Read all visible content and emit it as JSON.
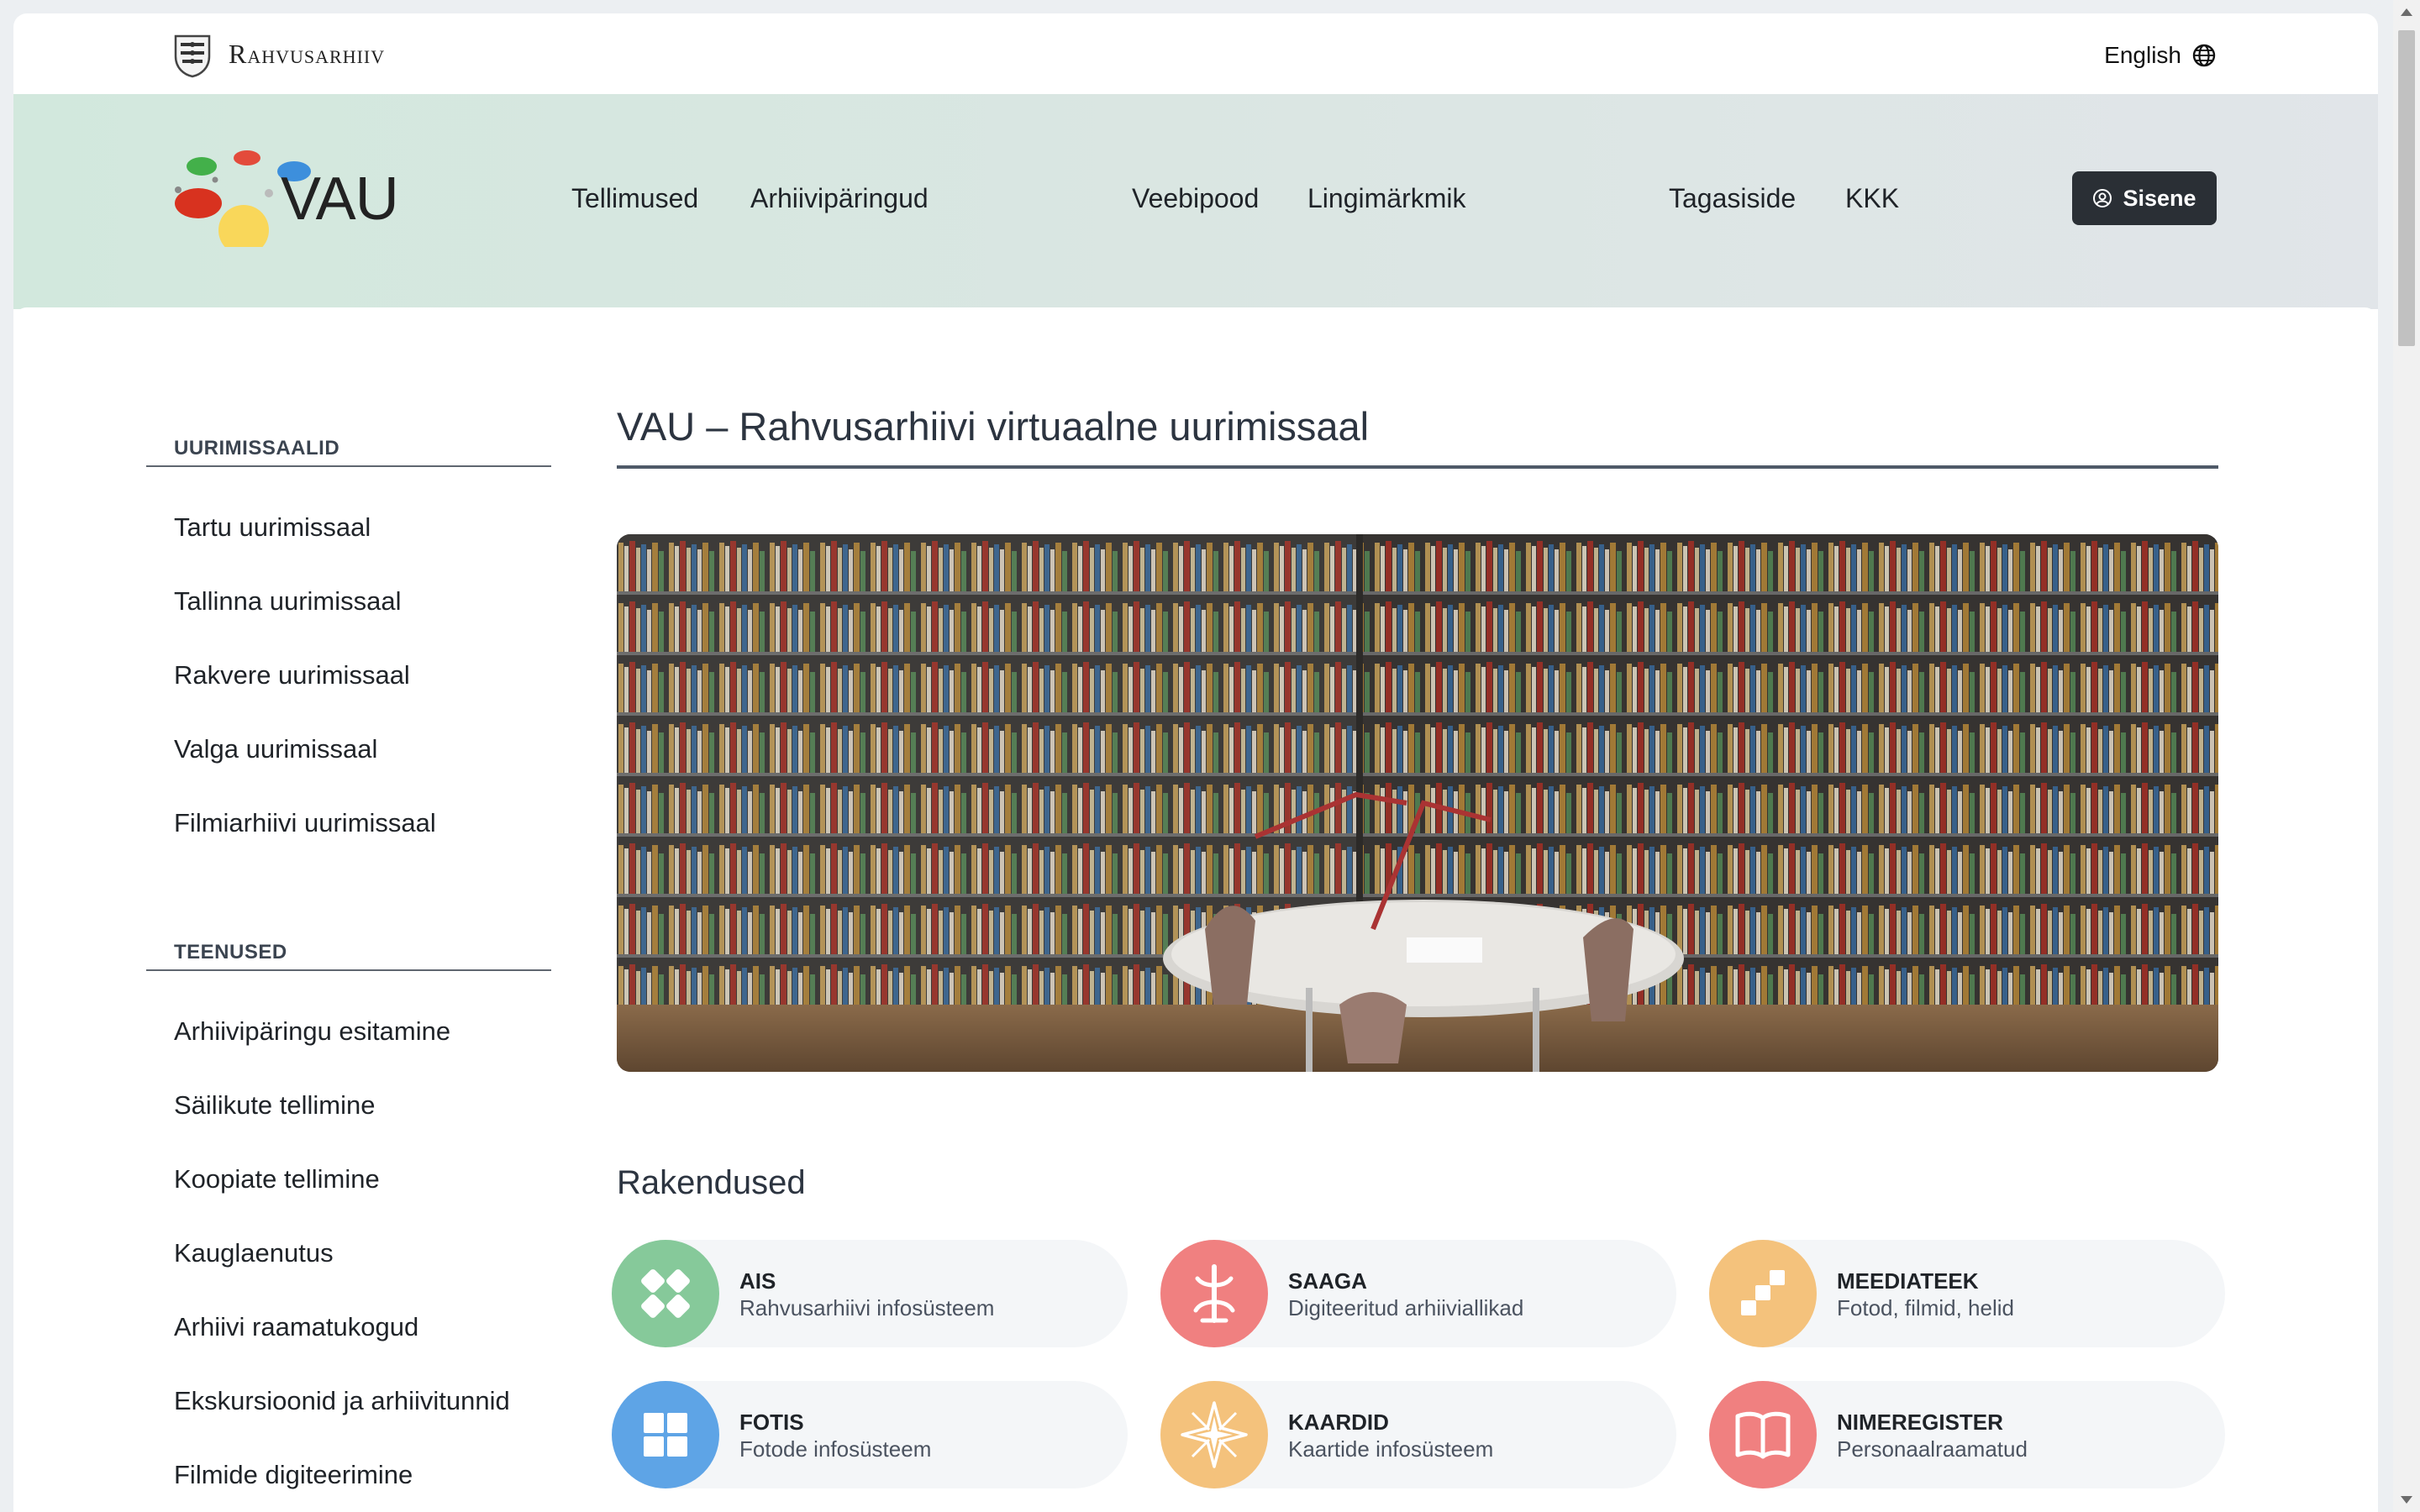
{
  "topbar": {
    "site_name": "Rahvusarhiiv",
    "language_label": "English"
  },
  "header": {
    "logo_text": "VAU",
    "nav": [
      {
        "label": "Tellimused"
      },
      {
        "label": "Arhiivipäringud"
      },
      {
        "label": "Veebipood"
      },
      {
        "label": "Lingimärkmik"
      },
      {
        "label": "Tagasiside"
      },
      {
        "label": "KKK"
      }
    ],
    "login_label": "Sisene"
  },
  "sidebar": {
    "reading_rooms_heading": "UURIMISSAALID",
    "reading_rooms": [
      {
        "label": "Tartu uurimissaal"
      },
      {
        "label": "Tallinna uurimissaal"
      },
      {
        "label": "Rakvere uurimissaal"
      },
      {
        "label": "Valga uurimissaal"
      },
      {
        "label": "Filmiarhiivi uurimissaal"
      }
    ],
    "services_heading": "TEENUSED",
    "services": [
      {
        "label": "Arhiivipäringu esitamine"
      },
      {
        "label": "Säilikute tellimine"
      },
      {
        "label": "Koopiate tellimine"
      },
      {
        "label": "Kauglaenutus"
      },
      {
        "label": "Arhiivi raamatukogud"
      },
      {
        "label": "Ekskursioonid ja arhiivitunnid"
      },
      {
        "label": "Filmide digiteerimine"
      }
    ]
  },
  "main": {
    "title": "VAU – Rahvusarhiivi virtuaalne uurimissaal",
    "apps_heading": "Rakendused",
    "apps": [
      {
        "name": "AIS",
        "description": "Rahvusarhiivi infosüsteem",
        "icon": "ais-icon",
        "color": "#86c99a"
      },
      {
        "name": "SAAGA",
        "description": "Digiteeritud arhiiviallikad",
        "icon": "saaga-tree-icon",
        "color": "#f08080"
      },
      {
        "name": "MEEDIATEEK",
        "description": "Fotod, filmid, helid",
        "icon": "meediateek-icon",
        "color": "#f4c27c"
      },
      {
        "name": "FOTIS",
        "description": "Fotode infosüsteem",
        "icon": "fotis-grid-icon",
        "color": "#5ea4e6"
      },
      {
        "name": "KAARDID",
        "description": "Kaartide infosüsteem",
        "icon": "compass-star-icon",
        "color": "#f4c27c"
      },
      {
        "name": "NIMEREGISTER",
        "description": "Personaalraamatud",
        "icon": "open-book-icon",
        "color": "#f08080"
      }
    ]
  }
}
